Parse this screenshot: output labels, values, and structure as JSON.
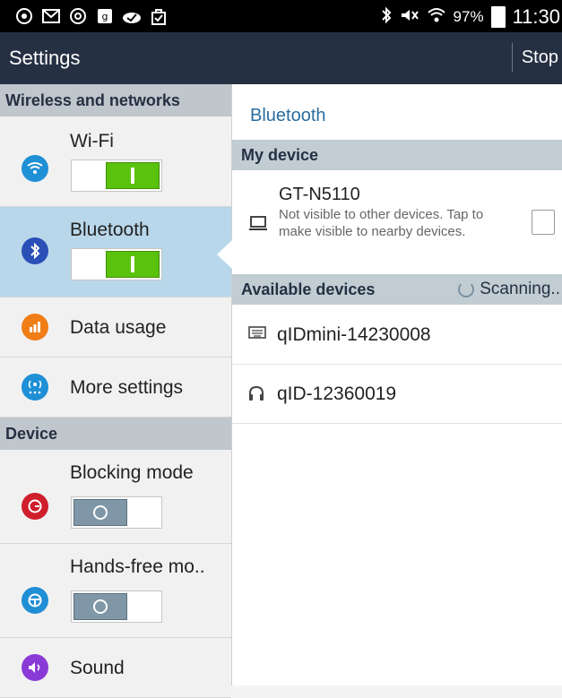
{
  "status_bar": {
    "left_icons": [
      "camera-icon",
      "gmail-icon",
      "chrome-icon",
      "google-plus-icon",
      "cloud-check-icon",
      "shopping-bag-icon"
    ],
    "battery": "97%",
    "time": "11:30"
  },
  "action_bar": {
    "title": "Settings",
    "stop": "Stop"
  },
  "sidebar": {
    "sections": [
      {
        "title": "Wireless and networks",
        "items": [
          {
            "label": "Wi-Fi",
            "icon": "wifi-icon",
            "color": "#1f8fd6",
            "toggle": "on"
          },
          {
            "label": "Bluetooth",
            "icon": "bluetooth-icon",
            "color": "#2a4fb7",
            "toggle": "on",
            "selected": true
          },
          {
            "label": "Data usage",
            "icon": "data-usage-icon",
            "color": "#f07d16"
          },
          {
            "label": "More settings",
            "icon": "more-settings-icon",
            "color": "#1f8fd6"
          }
        ]
      },
      {
        "title": "Device",
        "items": [
          {
            "label": "Blocking mode",
            "icon": "blocking-mode-icon",
            "color": "#cf1e2b",
            "toggle": "off"
          },
          {
            "label": "Hands-free mo..",
            "icon": "hands-free-icon",
            "color": "#1f8fd6",
            "toggle": "off"
          },
          {
            "label": "Sound",
            "icon": "sound-icon",
            "color": "#8a3ad6"
          }
        ]
      }
    ]
  },
  "bluetooth_panel": {
    "title": "Bluetooth",
    "my_device_header": "My device",
    "my_device": {
      "name": "GT-N5110",
      "description": "Not visible to other devices. Tap to make visible to nearby devices."
    },
    "available_header": "Available devices",
    "scanning": "Scanning..",
    "devices": [
      {
        "name": "qIDmini-14230008",
        "icon": "keyboard-icon"
      },
      {
        "name": "qID-12360019",
        "icon": "headphones-icon"
      }
    ]
  }
}
